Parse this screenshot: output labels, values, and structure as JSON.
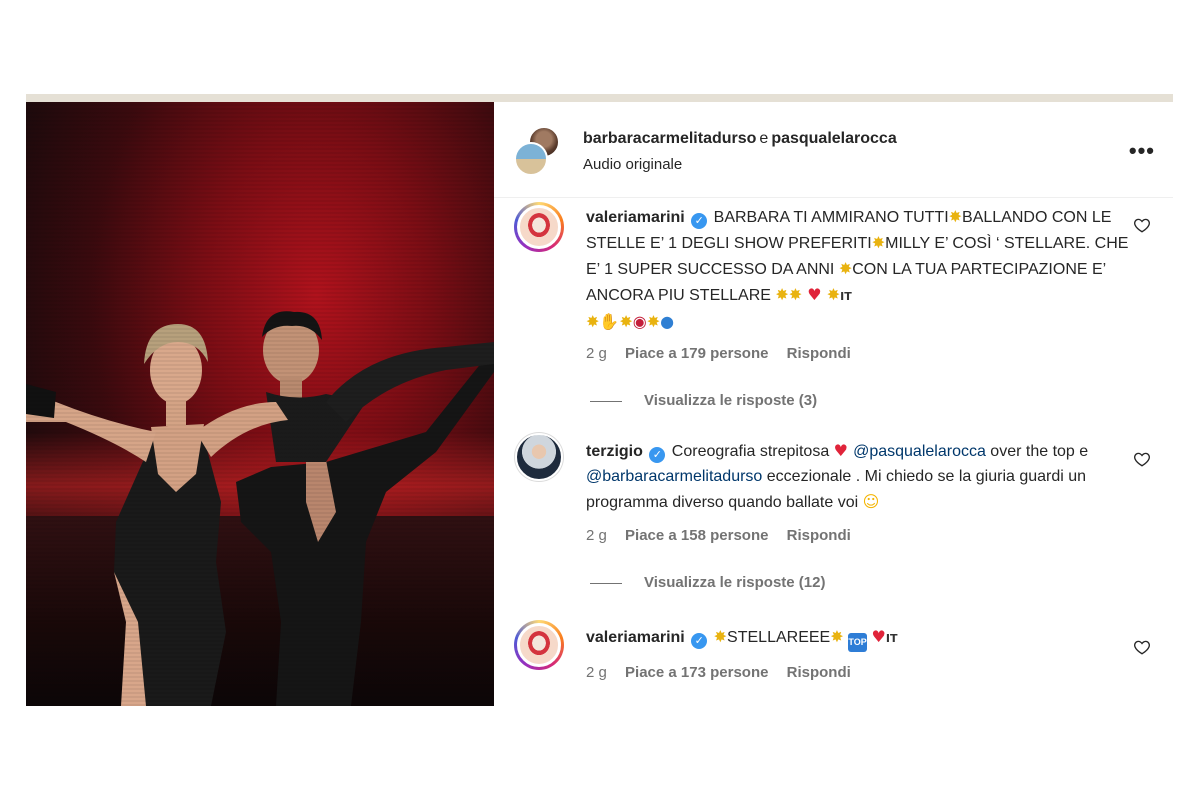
{
  "header": {
    "user1": "barbaracarmelitadurso",
    "conjunction": "e",
    "user2": "pasqualelarocca",
    "audio": "Audio originale",
    "more_label": "•••"
  },
  "comments": [
    {
      "user": "valeriamarini",
      "text_parts": [
        "BARBARA TI AMMIRANO TUTTI",
        "BALLANDO CON LE STELLE E’ 1 DEGLI SHOW PREFERITI",
        "MILLY E’ COSÌ ‘ STELLARE. CHE E’ 1 SUPER SUCCESSO DA ANNI ",
        "CON LA TUA PARTECIPAZIONE E’ ANCORA PIU STELLARE "
      ],
      "it_tag": "IT",
      "time": "2 g",
      "likes": "Piace a 179 persone",
      "reply": "Rispondi",
      "view_replies": "Visualizza le risposte (3)"
    },
    {
      "user": "terzigio",
      "text_a": "Coreografia strepitosa ",
      "mention1": "@pasqualelarocca",
      "text_b": " over the top e ",
      "mention2": "@barbaracarmelitadurso",
      "text_c": " eccezionale . Mi chiedo se la giuria guardi un programma diverso quando ballate voi ",
      "time": "2 g",
      "likes": "Piace a 158 persone",
      "reply": "Rispondi",
      "view_replies": "Visualizza le risposte (12)"
    },
    {
      "user": "valeriamarini",
      "text": "STELLAREEE",
      "top_label": "TOP",
      "it_tag": "IT",
      "time": "2 g",
      "likes": "Piace a 173 persone",
      "reply": "Rispondi"
    }
  ],
  "icons": {
    "verified": "verified-badge-icon",
    "like": "heart-outline-icon",
    "more": "more-horizontal-icon"
  },
  "colors": {
    "text": "#262626",
    "muted": "#737373",
    "mention": "#00376b",
    "verified": "#3897f0"
  }
}
